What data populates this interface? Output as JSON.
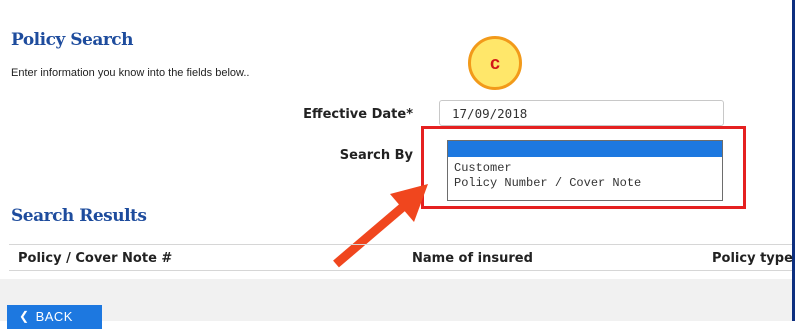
{
  "policy_search": {
    "title": "Policy Search",
    "intro": "Enter information you know into the fields below..",
    "effective_date_label": "Effective Date*",
    "effective_date_value": "17/09/2018",
    "search_by_label": "Search By",
    "search_by_options": [
      "",
      "Customer",
      "Policy Number / Cover Note"
    ],
    "search_by_selected_index": 0
  },
  "annotation": {
    "marker_label": "c",
    "highlight_color": "#e52020",
    "arrow_color": "#f0461e"
  },
  "search_results": {
    "title": "Search Results",
    "columns": [
      "Policy / Cover Note #",
      "Name of insured",
      "Policy type"
    ]
  },
  "back_button": {
    "label": "BACK",
    "icon": "chevron-left-icon"
  },
  "colors": {
    "brand_blue": "#1e4c9d",
    "accent_blue": "#1d78e0",
    "frame_navy": "#0d2f7f"
  }
}
